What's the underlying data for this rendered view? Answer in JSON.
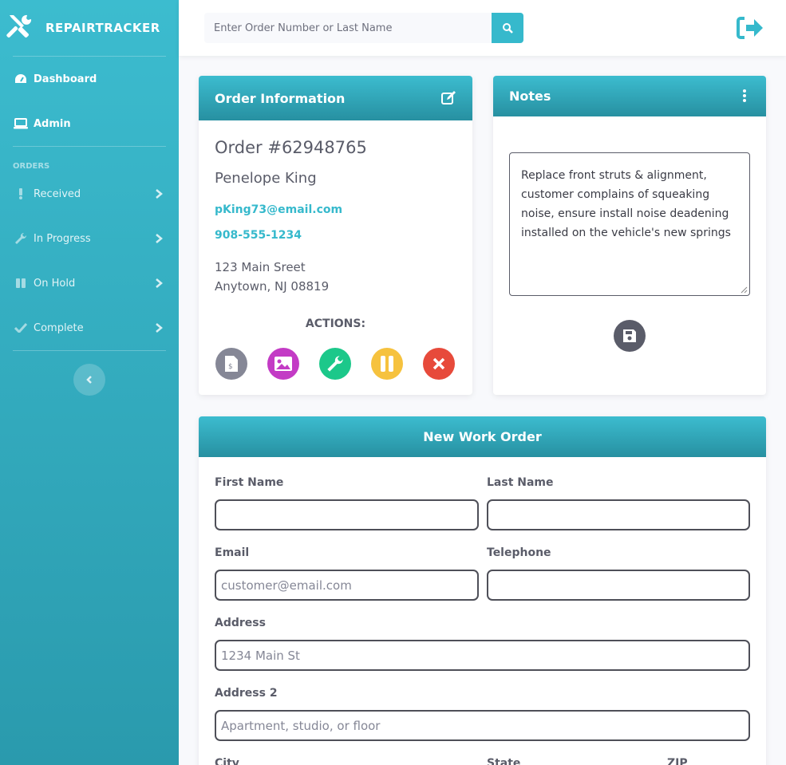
{
  "brand": {
    "name": "REPAIRTRACKER"
  },
  "sidebar": {
    "items": [
      {
        "label": "Dashboard",
        "icon": "tachometer-icon"
      },
      {
        "label": "Admin",
        "icon": "laptop-icon"
      }
    ],
    "orders_heading": "ORDERS",
    "order_items": [
      {
        "label": "Received",
        "icon": "exclamation-icon"
      },
      {
        "label": "In Progress",
        "icon": "wrench-icon"
      },
      {
        "label": "On Hold",
        "icon": "pause-icon"
      },
      {
        "label": "Complete",
        "icon": "check-icon"
      }
    ]
  },
  "search": {
    "placeholder": "Enter Order Number or Last Name"
  },
  "order": {
    "header": "Order Information",
    "number": "Order #62948765",
    "name": "Penelope King",
    "email": "pKing73@email.com",
    "phone": "908-555-1234",
    "address1": "123 Main Sreet",
    "address2": "Anytown, NJ 08819",
    "actions_label": "ACTIONS:",
    "actions": [
      {
        "name": "invoice-icon",
        "color": "#858796"
      },
      {
        "name": "image-icon",
        "color": "#c33bc5"
      },
      {
        "name": "wrench-icon",
        "color": "#1cc88a"
      },
      {
        "name": "pause-icon",
        "color": "#f6c23e"
      },
      {
        "name": "close-icon",
        "color": "#e74a3b"
      }
    ]
  },
  "notes": {
    "header": "Notes",
    "text": "Replace front struts & alignment, customer complains of squeaking noise, ensure install noise deadening installed on the vehicle's new springs"
  },
  "work_order": {
    "header": "New Work Order",
    "first_name_label": "First Name",
    "last_name_label": "Last Name",
    "email_label": "Email",
    "email_placeholder": "customer@email.com",
    "telephone_label": "Telephone",
    "address_label": "Address",
    "address_placeholder": "1234 Main St",
    "address2_label": "Address 2",
    "address2_placeholder": "Apartment, studio, or floor",
    "city_label": "City",
    "state_label": "State",
    "zip_label": "ZIP"
  },
  "colors": {
    "accent": "#36b9cc",
    "text": "#5a5c69"
  }
}
